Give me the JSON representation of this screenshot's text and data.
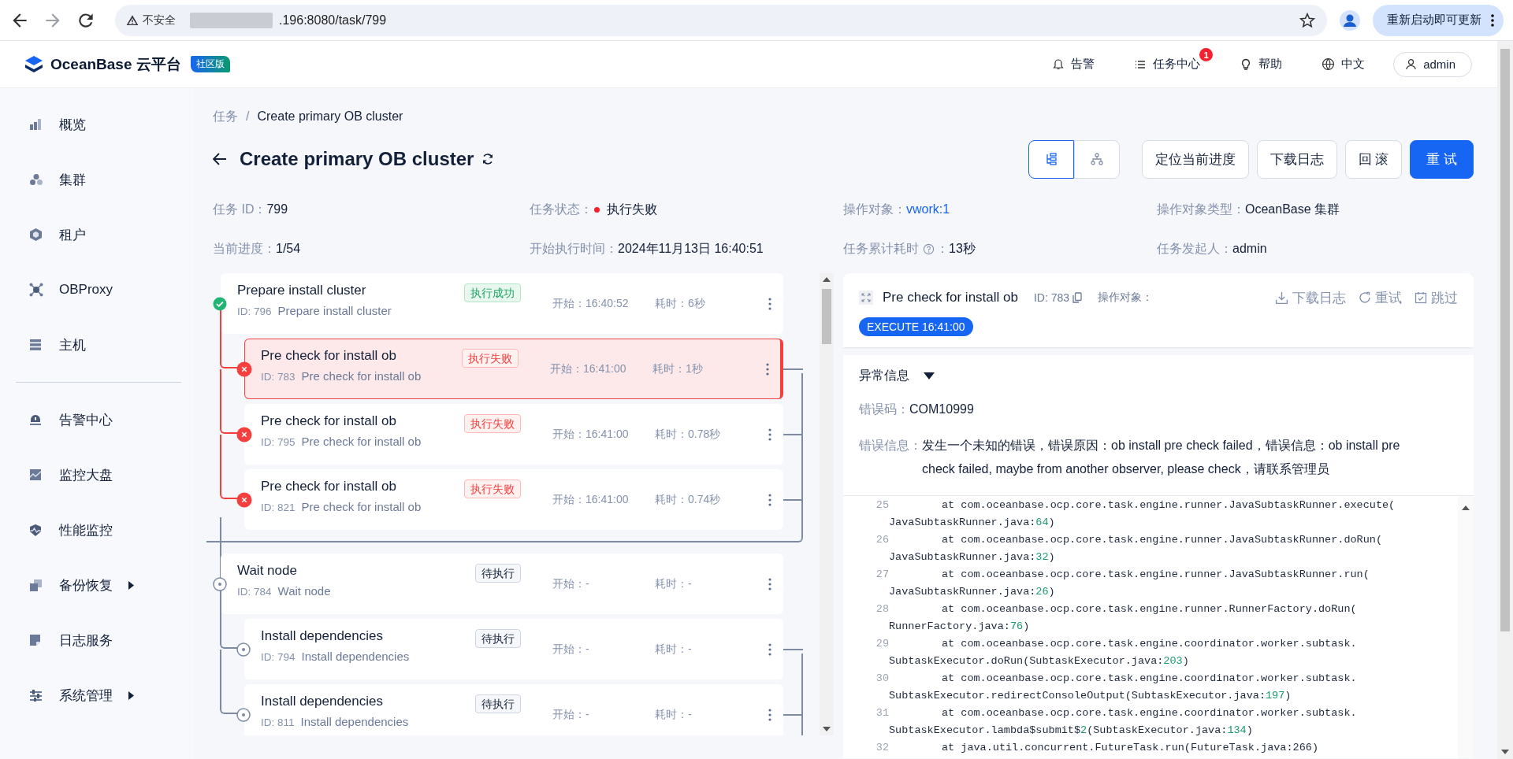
{
  "browser": {
    "security_label": "不安全",
    "url": ".196:8080/task/799",
    "update_button": "重新启动即可更新"
  },
  "header": {
    "logo": "OceanBase 云平台",
    "edition_badge": "社区版",
    "actions": [
      {
        "kind": "alert",
        "label": "告警"
      },
      {
        "kind": "tasks",
        "label": "任务中心",
        "badge": "1"
      },
      {
        "kind": "help",
        "label": "帮助"
      },
      {
        "kind": "language",
        "label": "中文"
      }
    ],
    "user": "admin"
  },
  "sidebar": {
    "groups": [
      [
        {
          "kind": "overview",
          "label": "概览",
          "expandable": false
        },
        {
          "kind": "cluster",
          "label": "集群",
          "expandable": false
        },
        {
          "kind": "tenant",
          "label": "租户",
          "expandable": false
        },
        {
          "kind": "proxy",
          "label": "OBProxy",
          "expandable": false
        },
        {
          "kind": "host",
          "label": "主机",
          "expandable": false
        }
      ],
      [
        {
          "kind": "alarm",
          "label": "告警中心",
          "expandable": false
        },
        {
          "kind": "dashboard",
          "label": "监控大盘",
          "expandable": false
        },
        {
          "kind": "performance",
          "label": "性能监控",
          "expandable": false
        },
        {
          "kind": "backup",
          "label": "备份恢复",
          "expandable": true
        },
        {
          "kind": "log",
          "label": "日志服务",
          "expandable": false
        },
        {
          "kind": "system",
          "label": "系统管理",
          "expandable": true
        }
      ]
    ]
  },
  "breadcrumb": {
    "separator": "/",
    "items": [
      {
        "label": "任务"
      },
      {
        "label": "Create primary OB cluster"
      }
    ]
  },
  "title": "Create primary OB cluster",
  "view_toggle": [
    {
      "kind": "list",
      "selected": true
    },
    {
      "kind": "tree",
      "selected": false
    }
  ],
  "buttons": [
    {
      "label": "定位当前进度",
      "primary": false
    },
    {
      "label": "下载日志",
      "primary": false
    },
    {
      "label": "回 滚",
      "primary": false
    },
    {
      "label": "重 试",
      "primary": true
    }
  ],
  "info": [
    {
      "kind": "plain",
      "label": "任务 ID：",
      "value": "799"
    },
    {
      "kind": "status",
      "label": "任务状态：",
      "value": "执行失败",
      "color": "#f5222d"
    },
    {
      "kind": "link",
      "label": "操作对象：",
      "value": "vwork:1"
    },
    {
      "kind": "plain",
      "label": "操作对象类型：",
      "value": "OceanBase 集群"
    },
    {
      "kind": "plain",
      "label": "当前进度：",
      "value": "1/54"
    },
    {
      "kind": "plain",
      "label": "开始执行时间：",
      "value": "2024年11月13日 16:40:51"
    },
    {
      "kind": "help",
      "label": "任务累计耗时",
      "label_suffix": "：",
      "value": "13秒"
    },
    {
      "kind": "plain",
      "label": "任务发起人：",
      "value": "admin"
    }
  ],
  "tasks": [
    {
      "kind": "success",
      "name": "Prepare install cluster",
      "id_label": "ID: 796",
      "description": "Prepare install cluster",
      "status_label": "执行成功",
      "start": "开始：16:40:52",
      "duration": "耗时：6秒",
      "selected": false,
      "children": [
        {
          "kind": "failed",
          "name": "Pre check for install ob",
          "id_label": "ID: 783",
          "description": "Pre check for install ob",
          "status_label": "执行失败",
          "start": "开始：16:41:00",
          "duration": "耗时：1秒",
          "selected": true
        },
        {
          "kind": "failed",
          "name": "Pre check for install ob",
          "id_label": "ID: 795",
          "description": "Pre check for install ob",
          "status_label": "执行失败",
          "start": "开始：16:41:00",
          "duration": "耗时：0.78秒",
          "selected": false
        },
        {
          "kind": "failed",
          "name": "Pre check for install ob",
          "id_label": "ID: 821",
          "description": "Pre check for install ob",
          "status_label": "执行失败",
          "start": "开始：16:41:00",
          "duration": "耗时：0.74秒",
          "selected": false
        }
      ]
    },
    {
      "kind": "pending",
      "name": "Wait node",
      "id_label": "ID: 784",
      "description": "Wait node",
      "status_label": "待执行",
      "start": "开始：-",
      "duration": "耗时：-",
      "selected": false,
      "children": [
        {
          "kind": "pending",
          "name": "Install dependencies",
          "id_label": "ID: 794",
          "description": "Install dependencies",
          "status_label": "待执行",
          "start": "开始：-",
          "duration": "耗时：-",
          "selected": false
        },
        {
          "kind": "pending",
          "name": "Install dependencies",
          "id_label": "ID: 811",
          "description": "Install dependencies",
          "status_label": "待执行",
          "start": "开始：-",
          "duration": "耗时：-",
          "selected": false
        }
      ]
    }
  ],
  "detail": {
    "title": "Pre check for install ob",
    "id_label": "ID: 783",
    "target_label": "操作对象：",
    "actions": [
      {
        "kind": "download",
        "label": "下载日志"
      },
      {
        "kind": "retry",
        "label": "重试"
      },
      {
        "kind": "skip",
        "label": "跳过"
      }
    ],
    "execute_tag": "EXECUTE 16:41:00",
    "error": {
      "title": "异常信息",
      "expanded": true,
      "code_label": "错误码：",
      "code": "COM10999",
      "message_label": "错误信息：",
      "message": "发生一个未知的错误，错误原因：ob install pre check failed，错误信息：ob install pre check failed, maybe from another observer, please check，请联系管理员"
    },
    "log": [
      {
        "number": "25",
        "text": "at com.oceanbase.ocp.core.task.engine.runner.JavaSubtaskRunner.execute(",
        "wrap": "JavaSubtaskRunner.java:64)"
      },
      {
        "number": "26",
        "text": "at com.oceanbase.ocp.core.task.engine.runner.JavaSubtaskRunner.doRun(",
        "wrap": "JavaSubtaskRunner.java:32)"
      },
      {
        "number": "27",
        "text": "at com.oceanbase.ocp.core.task.engine.runner.JavaSubtaskRunner.run(",
        "wrap": "JavaSubtaskRunner.java:26)"
      },
      {
        "number": "28",
        "text": "at com.oceanbase.ocp.core.task.engine.runner.RunnerFactory.doRun(",
        "wrap": "RunnerFactory.java:76)"
      },
      {
        "number": "29",
        "text": "at com.oceanbase.ocp.core.task.engine.coordinator.worker.subtask.",
        "wrap": "SubtaskExecutor.doRun(SubtaskExecutor.java:203)"
      },
      {
        "number": "30",
        "text": "at com.oceanbase.ocp.core.task.engine.coordinator.worker.subtask.",
        "wrap": "SubtaskExecutor.redirectConsoleOutput(SubtaskExecutor.java:197)"
      },
      {
        "number": "31",
        "text": "at com.oceanbase.ocp.core.task.engine.coordinator.worker.subtask.",
        "wrap": "SubtaskExecutor.lambda$submit$2(SubtaskExecutor.java:134)"
      },
      {
        "number": "32",
        "text": "at java.util.concurrent.FutureTask.run(FutureTask.java:266)"
      }
    ]
  }
}
